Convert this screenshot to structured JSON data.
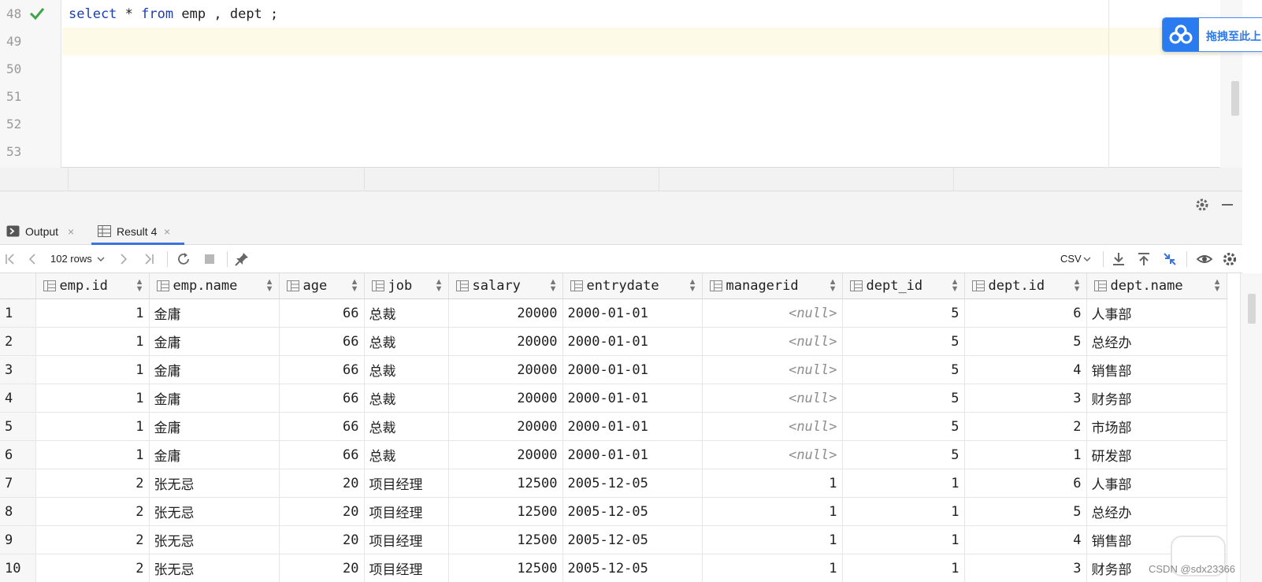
{
  "editor": {
    "lines": [
      {
        "number": "48",
        "text": "select * from emp , dept ;",
        "executed": true,
        "current": false
      },
      {
        "number": "49",
        "text": "",
        "executed": false,
        "current": true
      },
      {
        "number": "50",
        "text": "",
        "executed": false,
        "current": false
      },
      {
        "number": "51",
        "text": "",
        "executed": false,
        "current": false
      },
      {
        "number": "52",
        "text": "",
        "executed": false,
        "current": false
      },
      {
        "number": "53",
        "text": "",
        "executed": false,
        "current": false
      }
    ]
  },
  "overlay": {
    "label": "拖拽至此上",
    "icon": "cloud-icon"
  },
  "tabs": [
    {
      "label": "Output",
      "close": "×",
      "active": false,
      "icon": "console-icon"
    },
    {
      "label": "Result 4",
      "close": "×",
      "active": true,
      "icon": "table-icon"
    }
  ],
  "toolbar": {
    "row_count": "102 rows",
    "export_format": "CSV"
  },
  "grid": {
    "columns": [
      {
        "label": "emp.id",
        "align": "num"
      },
      {
        "label": "emp.name",
        "align": "txt"
      },
      {
        "label": "age",
        "align": "num"
      },
      {
        "label": "job",
        "align": "txt"
      },
      {
        "label": "salary",
        "align": "num"
      },
      {
        "label": "entrydate",
        "align": "mono"
      },
      {
        "label": "managerid",
        "align": "num"
      },
      {
        "label": "dept_id",
        "align": "num"
      },
      {
        "label": "dept.id",
        "align": "num"
      },
      {
        "label": "dept.name",
        "align": "txt"
      }
    ],
    "rows": [
      {
        "n": "1",
        "cells": [
          "1",
          "金庸",
          "66",
          "总裁",
          "20000",
          "2000-01-01",
          "<null>",
          "5",
          "6",
          "人事部"
        ]
      },
      {
        "n": "2",
        "cells": [
          "1",
          "金庸",
          "66",
          "总裁",
          "20000",
          "2000-01-01",
          "<null>",
          "5",
          "5",
          "总经办"
        ]
      },
      {
        "n": "3",
        "cells": [
          "1",
          "金庸",
          "66",
          "总裁",
          "20000",
          "2000-01-01",
          "<null>",
          "5",
          "4",
          "销售部"
        ]
      },
      {
        "n": "4",
        "cells": [
          "1",
          "金庸",
          "66",
          "总裁",
          "20000",
          "2000-01-01",
          "<null>",
          "5",
          "3",
          "财务部"
        ]
      },
      {
        "n": "5",
        "cells": [
          "1",
          "金庸",
          "66",
          "总裁",
          "20000",
          "2000-01-01",
          "<null>",
          "5",
          "2",
          "市场部"
        ]
      },
      {
        "n": "6",
        "cells": [
          "1",
          "金庸",
          "66",
          "总裁",
          "20000",
          "2000-01-01",
          "<null>",
          "5",
          "1",
          "研发部"
        ]
      },
      {
        "n": "7",
        "cells": [
          "2",
          "张无忌",
          "20",
          "项目经理",
          "12500",
          "2005-12-05",
          "1",
          "1",
          "6",
          "人事部"
        ]
      },
      {
        "n": "8",
        "cells": [
          "2",
          "张无忌",
          "20",
          "项目经理",
          "12500",
          "2005-12-05",
          "1",
          "1",
          "5",
          "总经办"
        ]
      },
      {
        "n": "9",
        "cells": [
          "2",
          "张无忌",
          "20",
          "项目经理",
          "12500",
          "2005-12-05",
          "1",
          "1",
          "4",
          "销售部"
        ]
      },
      {
        "n": "10",
        "cells": [
          "2",
          "张无忌",
          "20",
          "项目经理",
          "12500",
          "2005-12-05",
          "1",
          "1",
          "3",
          "财务部"
        ]
      }
    ]
  },
  "watermark": "CSDN @sdx23366",
  "colors": {
    "keyword": "#1b3fb5",
    "check": "#3ea34a",
    "active_tab": "#3d73e0",
    "null_text": "#8d8d8d"
  }
}
